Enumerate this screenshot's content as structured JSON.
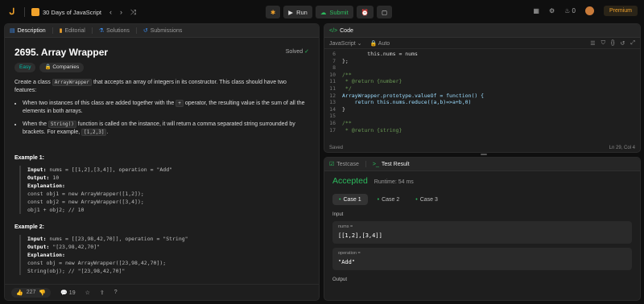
{
  "header": {
    "logo": "leetcode-logo-icon",
    "list_title": "30 Days of JavaScript",
    "run_label": "Run",
    "submit_label": "Submit",
    "premium_label": "Premium",
    "streak_count": "0"
  },
  "description": {
    "tabs": [
      {
        "label": "Description"
      },
      {
        "label": "Editorial"
      },
      {
        "label": "Solutions"
      },
      {
        "label": "Submissions"
      }
    ],
    "title": "2695. Array Wrapper",
    "solved": "Solved",
    "difficulty": "Easy",
    "companies": "Companies",
    "intro_a": "Create a class ",
    "intro_code": "ArrayWrapper",
    "intro_b": " that accepts an array of integers in its constructor. This class should have two features:",
    "b1_a": "When two instances of this class are added together with the ",
    "b1_code": "+",
    "b1_b": " operator, the resulting value is the sum of all the elements in both arrays.",
    "b2_a": "When the ",
    "b2_code": "String()",
    "b2_b": " function is called on the instance, it will return a comma separated string surrounded by brackets. For example, ",
    "b2_code2": "[1,2,3]",
    "b2_c": ".",
    "ex1_title": "Example 1:",
    "ex1": {
      "input_label": "Input:",
      "input": " nums = [[1,2],[3,4]], operation = \"Add\"",
      "output_label": "Output:",
      "output": " 10",
      "expl_label": "Explanation:",
      "lines": [
        "const obj1 = new ArrayWrapper([1,2]);",
        "const obj2 = new ArrayWrapper([3,4]);",
        "obj1 + obj2; // 10"
      ]
    },
    "ex2_title": "Example 2:",
    "ex2": {
      "input_label": "Input:",
      "input": " nums = [[23,98,42,70]], operation = \"String\"",
      "output_label": "Output:",
      "output": " \"[23,98,42,70]\"",
      "expl_label": "Explanation:",
      "lines": [
        "const obj = new ArrayWrapper([23,98,42,70]);",
        "String(obj); // \"[23,98,42,70]\""
      ]
    },
    "likes": "227",
    "comments": "19"
  },
  "code": {
    "tab_label": "Code",
    "language": "JavaScript",
    "mode": "Auto",
    "lines": [
      {
        "n": "6",
        "t": "        this.nums = nums"
      },
      {
        "n": "7",
        "t": "};"
      },
      {
        "n": "8",
        "t": ""
      },
      {
        "n": "10",
        "t": "/**"
      },
      {
        "n": "11",
        "t": " * @return {number}"
      },
      {
        "n": "11",
        "t": " */"
      },
      {
        "n": "12",
        "t": "ArrayWrapper.prototype.valueOf = function() {"
      },
      {
        "n": "13",
        "t": "    return this.nums.reduce((a,b)=>a+b,0)"
      },
      {
        "n": "14",
        "t": "}"
      },
      {
        "n": "15",
        "t": ""
      },
      {
        "n": "16",
        "t": "/**"
      },
      {
        "n": "17",
        "t": " * @return {string}"
      }
    ],
    "saved": "Saved",
    "cursor": "Ln 29, Col 4"
  },
  "result": {
    "tabs": [
      {
        "label": "Testcase"
      },
      {
        "label": "Test Result"
      }
    ],
    "status": "Accepted",
    "runtime": "Runtime: 54 ms",
    "cases": [
      {
        "label": "Case 1"
      },
      {
        "label": "Case 2"
      },
      {
        "label": "Case 3"
      }
    ],
    "input_label": "Input",
    "nums_label": "nums =",
    "nums_value": "[[1,2],[3,4]]",
    "op_label": "operation =",
    "op_value": "\"Add\"",
    "output_label": "Output"
  },
  "colors": {
    "accent": "#f0a22b",
    "success": "#2cbb5d",
    "easy": "#00b8a3"
  }
}
